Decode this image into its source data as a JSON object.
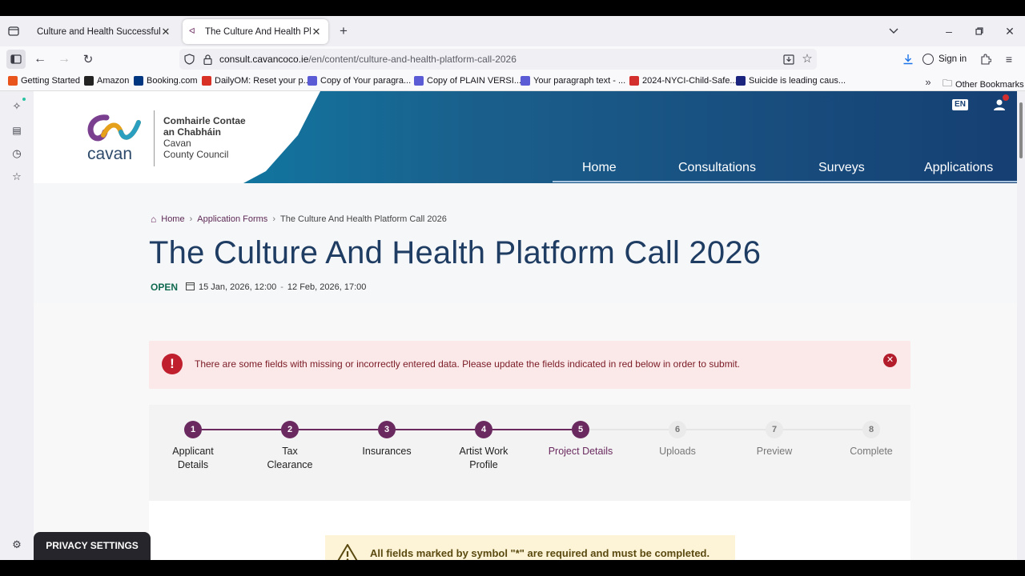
{
  "tabs": [
    {
      "title": "Culture and Health Successful Appli"
    },
    {
      "title": "The Culture And Health Platform"
    }
  ],
  "nav": {
    "url_host": "consult.cavancoco.ie",
    "url_path": "/en/content/culture-and-health-platform-call-2026",
    "sign_in": "Sign in"
  },
  "bookmarks": [
    {
      "label": "Getting Started",
      "color": "#e8541c"
    },
    {
      "label": "Amazon",
      "color": "#222222"
    },
    {
      "label": "Booking.com",
      "color": "#003580"
    },
    {
      "label": "DailyOM: Reset your p...",
      "color": "#d93025"
    },
    {
      "label": "Copy of Your paragra...",
      "color": "#5b5bd6"
    },
    {
      "label": "Copy of PLAIN VERSI...",
      "color": "#5b5bd6"
    },
    {
      "label": "Your paragraph text - ...",
      "color": "#5b5bd6"
    },
    {
      "label": "2024-NYCI-Child-Safe...",
      "color": "#d32f2f"
    },
    {
      "label": "Suicide is leading caus...",
      "color": "#1a237e"
    }
  ],
  "other_bookmarks": "Other Bookmarks",
  "site": {
    "logo_word": "cavan",
    "logo_lines": [
      "Comhairle Contae",
      "an Chabháin",
      "Cavan",
      "County Council"
    ],
    "lang": "EN",
    "menu": [
      "Home",
      "Consultations",
      "Surveys",
      "Applications"
    ]
  },
  "breadcrumb": [
    "Home",
    "Application Forms",
    "The Culture And Health Platform Call 2026"
  ],
  "page": {
    "title": "The Culture And Health Platform Call 2026",
    "status": "OPEN",
    "date_start": "15 Jan, 2026, 12:00",
    "date_end": "12 Feb, 2026, 17:00"
  },
  "alert": {
    "text": "There are some fields with missing or incorrectly entered data. Please update the fields indicated in red below in order to submit."
  },
  "steps": [
    {
      "num": "1",
      "label": "Applicant Details",
      "state": "done"
    },
    {
      "num": "2",
      "label": "Tax Clearance",
      "state": "done"
    },
    {
      "num": "3",
      "label": "Insurances",
      "state": "done"
    },
    {
      "num": "4",
      "label": "Artist Work Profile",
      "state": "done"
    },
    {
      "num": "5",
      "label": "Project Details",
      "state": "current"
    },
    {
      "num": "6",
      "label": "Uploads",
      "state": "todo"
    },
    {
      "num": "7",
      "label": "Preview",
      "state": "todo"
    },
    {
      "num": "8",
      "label": "Complete",
      "state": "todo"
    }
  ],
  "note": {
    "text": "All fields marked by symbol \"*\" are required and must be completed."
  },
  "privacy": "PRIVACY SETTINGS",
  "colors": {
    "brand_purple": "#6a2a5f",
    "title_blue": "#1f3d63",
    "error_red": "#c0202e",
    "status_green": "#0f6a50"
  }
}
